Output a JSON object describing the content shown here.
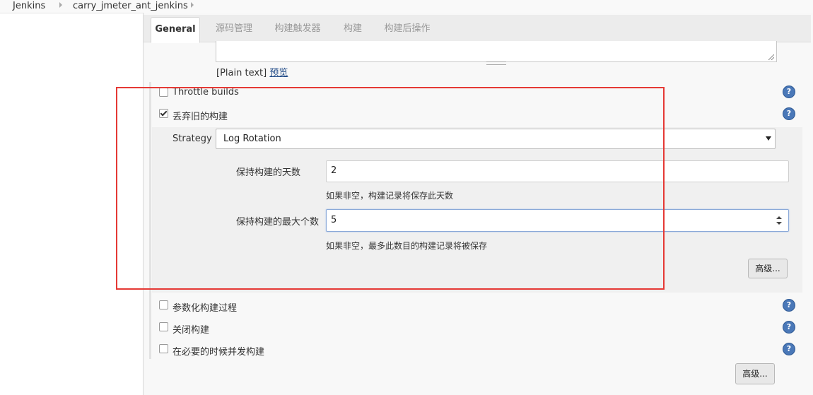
{
  "breadcrumb": {
    "items": [
      "Jenkins",
      "carry_jmeter_ant_jenkins"
    ]
  },
  "tabs": [
    {
      "label": "General",
      "active": true
    },
    {
      "label": "源码管理",
      "active": false
    },
    {
      "label": "构建触发器",
      "active": false
    },
    {
      "label": "构建",
      "active": false
    },
    {
      "label": "构建后操作",
      "active": false
    }
  ],
  "description": {
    "format_text": "[Plain text]",
    "preview_link": "预览"
  },
  "options": {
    "throttle": {
      "label": "Throttle builds",
      "checked": false
    },
    "discard_old": {
      "label": "丢弃旧的构建",
      "checked": true
    },
    "parameterized": {
      "label": "参数化构建过程",
      "checked": false
    },
    "disable_build": {
      "label": "关闭构建",
      "checked": false
    },
    "concurrent": {
      "label": "在必要的时候并发构建",
      "checked": false
    }
  },
  "strategy": {
    "label": "Strategy",
    "selected": "Log Rotation",
    "days_label": "保持构建的天数",
    "days_value": "2",
    "days_hint": "如果非空，构建记录将保存此天数",
    "max_label": "保持构建的最大个数",
    "max_value": "5",
    "max_hint": "如果非空，最多此数目的构建记录将被保存",
    "advanced_label": "高级..."
  },
  "footer": {
    "advanced_label": "高级..."
  },
  "colors": {
    "annotation_box": "#e53935",
    "help_icon": "#4a78b8"
  }
}
